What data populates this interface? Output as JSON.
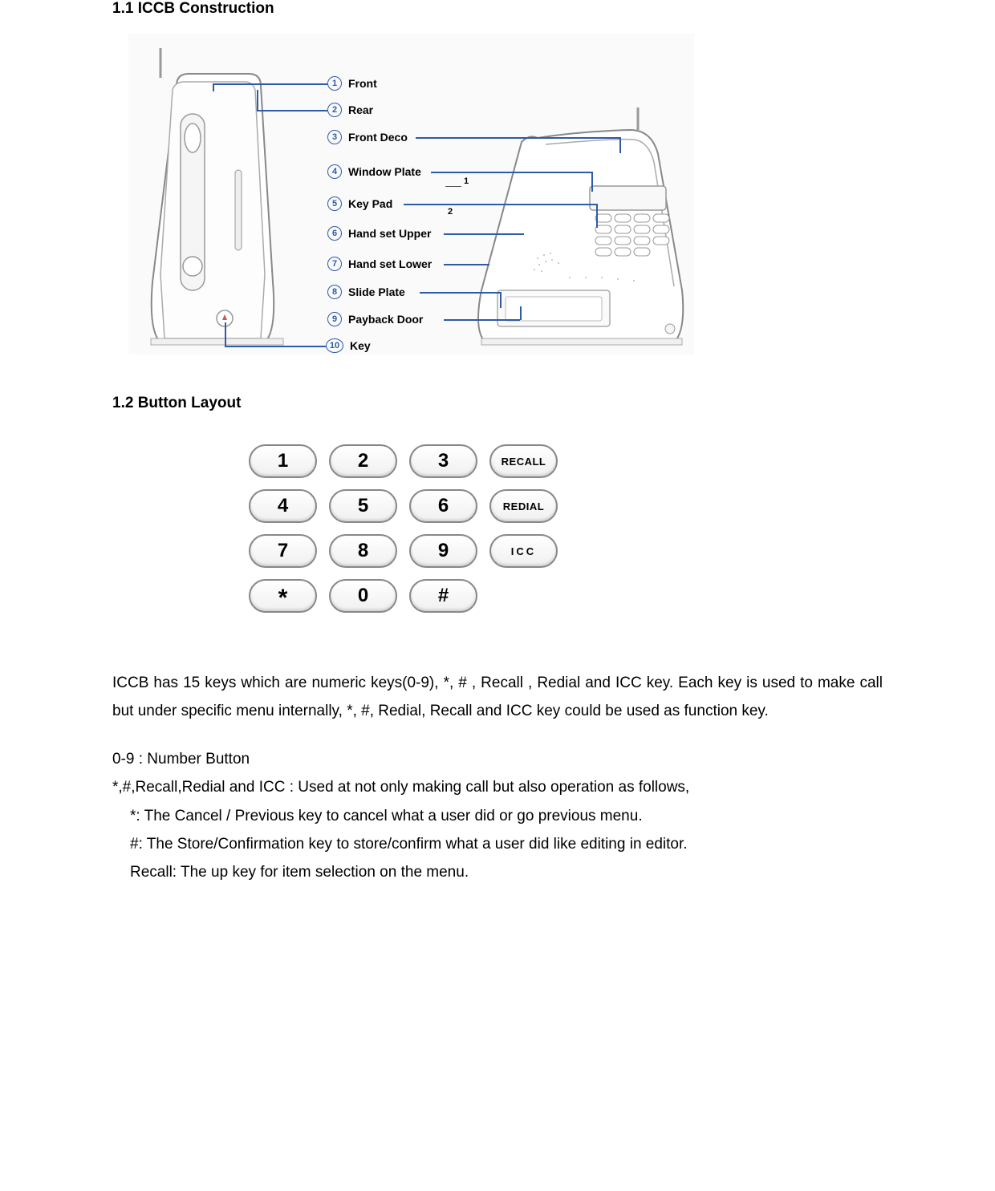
{
  "headings": {
    "h1_1": "1.1 ICCB Construction",
    "h1_2": "1.2 Button Layout"
  },
  "construction_labels": [
    {
      "n": "1",
      "text": "Front"
    },
    {
      "n": "2",
      "text": "Rear"
    },
    {
      "n": "3",
      "text": "Front Deco"
    },
    {
      "n": "4",
      "text": "Window Plate"
    },
    {
      "n": "5",
      "text": "Key Pad"
    },
    {
      "n": "6",
      "text": "Hand set  Upper"
    },
    {
      "n": "7",
      "text": "Hand set  Lower"
    },
    {
      "n": "8",
      "text": "Slide Plate"
    },
    {
      "n": "9",
      "text": "Payback Door"
    },
    {
      "n": "10",
      "text": "Key"
    }
  ],
  "diagram_annotations": {
    "a1": "1",
    "a2": "2"
  },
  "keypad": {
    "rows": [
      [
        "1",
        "2",
        "3",
        "RECALL"
      ],
      [
        "4",
        "5",
        "6",
        "REDIAL"
      ],
      [
        "7",
        "8",
        "9",
        "ICC"
      ],
      [
        "*",
        "0",
        "#"
      ]
    ]
  },
  "paragraph": "ICCB has 15 keys which are numeric keys(0-9), *, # , Recall , Redial and ICC key. Each key is used to make call but under specific menu internally, *, #, Redial, Recall and ICC key could be used as function key.",
  "defs": {
    "line1": "0-9 :   Number Button",
    "line2": "*,#,Recall,Redial and ICC : Used at not only making call but also operation as follows,",
    "line3": "*: The Cancel / Previous key to cancel what a user did or go previous menu.",
    "line4": "#: The Store/Confirmation key to store/confirm what a user did like editing in editor.",
    "line5": "Recall: The up key for item selection on the menu."
  }
}
